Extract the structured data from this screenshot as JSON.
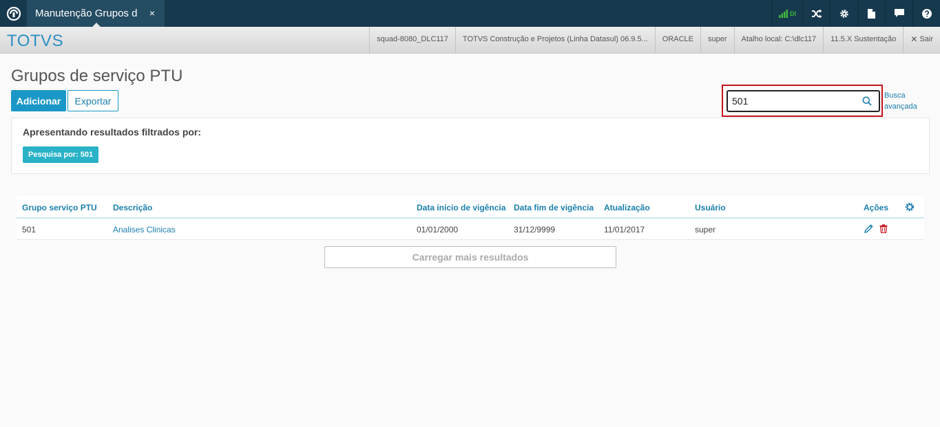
{
  "topbar": {
    "tab_label": "Manutenção Grupos d",
    "tab_close": "×",
    "signal_label": "DI"
  },
  "brandbar": {
    "brand": "TOTVS",
    "items": [
      "squad-8080_DLC117",
      "TOTVS Construção e Projetos (Linha Datasul) 06.9.5...",
      "ORACLE",
      "super",
      "Atalho local: C:\\dlc117",
      "11.5.X Sustentação"
    ],
    "sair": "Sair"
  },
  "page": {
    "title": "Grupos de serviço PTU",
    "add_label": "Adicionar",
    "export_label": "Exportar",
    "search_value": "501",
    "advanced_line1": "Busca",
    "advanced_line2": "avançada"
  },
  "filter": {
    "title": "Apresentando resultados filtrados por:",
    "tag": "Pesquisa por: 501"
  },
  "table": {
    "headers": {
      "grupo": "Grupo serviço PTU",
      "descricao": "Descrição",
      "inicio": "Data início de vigência",
      "fim": "Data fim de vigência",
      "atualizacao": "Atualização",
      "usuario": "Usuário",
      "acoes": "Ações"
    },
    "rows": [
      {
        "grupo": "501",
        "descricao": "Analises Clinicas",
        "inicio": "01/01/2000",
        "fim": "31/12/9999",
        "atualizacao": "11/01/2017",
        "usuario": "super"
      }
    ]
  },
  "load_more": "Carregar mais resultados",
  "colors": {
    "topbar": "#17394d",
    "accent": "#1a97c6",
    "highlight": "#c4121b",
    "tag": "#2ab2c7"
  }
}
